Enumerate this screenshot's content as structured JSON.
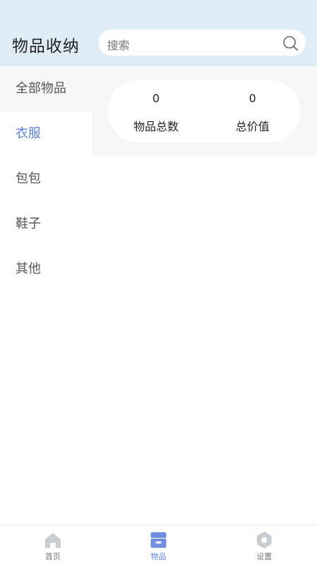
{
  "header": {
    "title": "物品收纳",
    "search_placeholder": "搜索"
  },
  "sidebar": {
    "items": [
      {
        "label": "全部物品"
      },
      {
        "label": "衣服"
      },
      {
        "label": "包包"
      },
      {
        "label": "鞋子"
      },
      {
        "label": "其他"
      }
    ],
    "active_index": 1
  },
  "stats": {
    "total_count": "0",
    "total_count_label": "物品总数",
    "total_value": "0",
    "total_value_label": "总价值"
  },
  "tabbar": {
    "tabs": [
      {
        "label": "首页",
        "icon": "home-icon"
      },
      {
        "label": "物品",
        "icon": "box-icon"
      },
      {
        "label": "设置",
        "icon": "settings-icon"
      }
    ],
    "active_index": 1
  },
  "colors": {
    "accent": "#5b7fd8",
    "header_bg": "#deedf5",
    "panel_bg": "#f4f6f8"
  }
}
